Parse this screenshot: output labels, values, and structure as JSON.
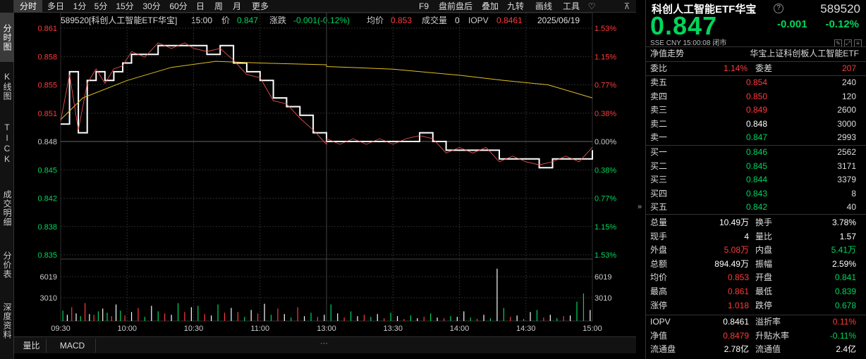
{
  "left_tabs": [
    {
      "label": "分时图",
      "active": true
    },
    {
      "label": "K线图",
      "active": false
    },
    {
      "label": "TICK",
      "active": false
    },
    {
      "label": "成交明细",
      "active": false
    },
    {
      "label": "分价表",
      "active": false
    },
    {
      "label": "深度资料",
      "active": false
    }
  ],
  "toolbar": {
    "tabs": [
      "分时",
      "多日",
      "1分",
      "5分",
      "15分",
      "30分",
      "60分",
      "日",
      "周",
      "月",
      "更多"
    ],
    "right_items": [
      "F9",
      "盘前盘后",
      "叠加",
      "九转",
      "画线",
      "工具"
    ],
    "favorite_icon": "heart-icon"
  },
  "infobar": {
    "name": "589520[科创人工智能ETF华宝]",
    "time": "15:00",
    "price_label": "价",
    "price": "0.847",
    "change_label": "涨跌",
    "change": "-0.001(-0.12%)",
    "avg_label": "均价",
    "avg": "0.853",
    "volume_label": "成交量",
    "volume": "0",
    "iopv_label": "IOPV",
    "iopv": "0.8461",
    "date": "2025/06/19"
  },
  "axes": {
    "price_ticks": [
      "0.861",
      "0.858",
      "0.855",
      "0.851",
      "0.848",
      "0.845",
      "0.842",
      "0.838",
      "0.835"
    ],
    "pct_ticks": [
      "1.53%",
      "1.15%",
      "0.77%",
      "0.38%",
      "0.00%",
      "0.38%",
      "0.77%",
      "1.15%",
      "1.53%"
    ],
    "volume_ticks": [
      "6019",
      "3010"
    ],
    "time_ticks": [
      "09:30",
      "10:00",
      "10:30",
      "11:00",
      "13:00",
      "13:30",
      "14:00",
      "14:30",
      "15:00"
    ]
  },
  "chart_data": {
    "type": "line",
    "x_range": [
      "09:30",
      "15:00"
    ],
    "ylim": [
      0.835,
      0.861
    ],
    "prev_close": 0.848,
    "series": [
      {
        "name": "价",
        "color": "#ffffff",
        "x": [
          "09:30",
          "09:34",
          "09:38",
          "09:42",
          "09:46",
          "09:50",
          "09:54",
          "09:58",
          "10:02",
          "10:08",
          "10:14",
          "10:20",
          "10:26",
          "10:30",
          "10:36",
          "10:42",
          "10:48",
          "10:54",
          "11:00",
          "11:06",
          "11:12",
          "11:18",
          "11:24",
          "11:30",
          "13:00",
          "13:06",
          "13:12",
          "13:18",
          "13:24",
          "13:30",
          "13:36",
          "13:42",
          "13:48",
          "13:54",
          "14:00",
          "14:06",
          "14:12",
          "14:18",
          "14:24",
          "14:30",
          "14:36",
          "14:42",
          "14:48",
          "14:54",
          "15:00"
        ],
        "y": [
          0.85,
          0.856,
          0.849,
          0.855,
          0.856,
          0.855,
          0.856,
          0.857,
          0.858,
          0.858,
          0.859,
          0.859,
          0.859,
          0.859,
          0.858,
          0.859,
          0.857,
          0.856,
          0.855,
          0.853,
          0.852,
          0.851,
          0.849,
          0.848,
          0.848,
          0.848,
          0.848,
          0.848,
          0.848,
          0.848,
          0.848,
          0.849,
          0.848,
          0.847,
          0.847,
          0.847,
          0.847,
          0.846,
          0.846,
          0.846,
          0.845,
          0.846,
          0.846,
          0.846,
          0.847
        ]
      },
      {
        "name": "均价",
        "color": "#e0c020",
        "x": [
          "09:30",
          "09:40",
          "10:00",
          "10:20",
          "10:40",
          "11:00",
          "11:30",
          "13:00",
          "13:30",
          "14:00",
          "14:20",
          "14:40",
          "15:00"
        ],
        "y": [
          0.8505,
          0.853,
          0.855,
          0.8565,
          0.8572,
          0.857,
          0.8568,
          0.8566,
          0.8563,
          0.8556,
          0.855,
          0.8545,
          0.853
        ]
      }
    ],
    "volume": {
      "ylim": [
        0,
        9000
      ],
      "times": [
        "09:31",
        "09:33",
        "09:35",
        "09:37",
        "09:39",
        "09:41",
        "09:43",
        "09:45",
        "09:47",
        "09:49",
        "09:51",
        "09:53",
        "09:55",
        "09:57",
        "09:59",
        "10:02",
        "10:05",
        "10:08",
        "10:11",
        "10:14",
        "10:17",
        "10:20",
        "10:23",
        "10:26",
        "10:29",
        "10:32",
        "10:35",
        "10:38",
        "10:41",
        "10:44",
        "10:47",
        "10:50",
        "10:53",
        "10:56",
        "10:59",
        "11:02",
        "11:05",
        "11:08",
        "11:11",
        "11:14",
        "11:17",
        "11:20",
        "11:23",
        "11:26",
        "11:29",
        "13:02",
        "13:05",
        "13:08",
        "13:11",
        "13:14",
        "13:17",
        "13:20",
        "13:23",
        "13:26",
        "13:29",
        "13:32",
        "13:35",
        "13:38",
        "13:41",
        "13:44",
        "13:47",
        "13:50",
        "13:53",
        "13:56",
        "13:59",
        "14:02",
        "14:05",
        "14:08",
        "14:11",
        "14:14",
        "14:17",
        "14:20",
        "14:23",
        "14:26",
        "14:29",
        "14:32",
        "14:35",
        "14:38",
        "14:41",
        "14:44",
        "14:47",
        "14:50",
        "14:53",
        "14:56",
        "14:59"
      ],
      "values": [
        1500,
        900,
        2000,
        1100,
        700,
        2600,
        1000,
        900,
        1400,
        1800,
        1200,
        700,
        2400,
        1500,
        800,
        1300,
        1900,
        600,
        2200,
        1400,
        1100,
        900,
        2600,
        1300,
        2000,
        2200,
        1000,
        800,
        2400,
        1200,
        1900,
        1300,
        600,
        1600,
        1100,
        2500,
        900,
        1800,
        1000,
        500,
        2000,
        700,
        1200,
        600,
        900,
        2400,
        1100,
        500,
        1400,
        700,
        900,
        600,
        1000,
        400,
        1200,
        700,
        300,
        800,
        400,
        600,
        1100,
        500,
        400,
        700,
        600,
        1400,
        500,
        300,
        900,
        400,
        7600,
        1900,
        600,
        800,
        300,
        1300,
        1600,
        500,
        900,
        400,
        700,
        800,
        2800,
        4000,
        1600
      ],
      "colors": [
        "g",
        "w",
        "r",
        "w",
        "g",
        "r",
        "w",
        "r",
        "g",
        "w",
        "g",
        "r",
        "w",
        "g",
        "r",
        "w",
        "r",
        "g",
        "w",
        "g",
        "r",
        "w",
        "g",
        "r",
        "w",
        "g",
        "r",
        "w",
        "g",
        "r",
        "w",
        "r",
        "g",
        "w",
        "r",
        "w",
        "g",
        "r",
        "w",
        "g",
        "r",
        "w",
        "g",
        "r",
        "w",
        "g",
        "w",
        "r",
        "g",
        "w",
        "r",
        "g",
        "w",
        "r",
        "g",
        "w",
        "r",
        "g",
        "w",
        "r",
        "g",
        "w",
        "r",
        "g",
        "w",
        "w",
        "g",
        "r",
        "w",
        "g",
        "w",
        "g",
        "r",
        "w",
        "g",
        "w",
        "g",
        "r",
        "w",
        "g",
        "r",
        "w",
        "g",
        "g",
        "w"
      ]
    }
  },
  "bottom_tabs": [
    "量比",
    "MACD"
  ],
  "quote": {
    "name": "科创人工智能ETF华宝",
    "code": "589520",
    "price": "0.847",
    "change": "-0.001",
    "change_pct": "-0.12%",
    "meta": "SSE   CNY   15:00:08   闭市",
    "nav_trend_label": "净值走势",
    "index_name": "华宝上证科创板人工智能ETF",
    "webi_label": "委比",
    "webi_value": "1.14%",
    "weicha_label": "委差",
    "weicha_value": "207",
    "asks": [
      {
        "label": "卖五",
        "price": "0.854",
        "vol": "240",
        "color": "red"
      },
      {
        "label": "卖四",
        "price": "0.850",
        "vol": "120",
        "color": "red"
      },
      {
        "label": "卖三",
        "price": "0.849",
        "vol": "2600",
        "color": "red"
      },
      {
        "label": "卖二",
        "price": "0.848",
        "vol": "3000",
        "color": "white"
      },
      {
        "label": "卖一",
        "price": "0.847",
        "vol": "2993",
        "color": "green"
      }
    ],
    "bids": [
      {
        "label": "买一",
        "price": "0.846",
        "vol": "2562",
        "color": "green"
      },
      {
        "label": "买二",
        "price": "0.845",
        "vol": "3171",
        "color": "green"
      },
      {
        "label": "买三",
        "price": "0.844",
        "vol": "3379",
        "color": "green"
      },
      {
        "label": "买四",
        "price": "0.843",
        "vol": "8",
        "color": "green"
      },
      {
        "label": "买五",
        "price": "0.842",
        "vol": "40",
        "color": "green"
      }
    ],
    "stats": [
      {
        "l1": "总量",
        "v1": "10.49万",
        "c1": "white",
        "l2": "换手",
        "v2": "3.78%",
        "c2": "white"
      },
      {
        "l1": "现手",
        "v1": "4",
        "c1": "white",
        "l2": "量比",
        "v2": "1.57",
        "c2": "white"
      },
      {
        "l1": "外盘",
        "v1": "5.08万",
        "c1": "red",
        "l2": "内盘",
        "v2": "5.41万",
        "c2": "green"
      },
      {
        "l1": "总额",
        "v1": "894.49万",
        "c1": "white",
        "l2": "振幅",
        "v2": "2.59%",
        "c2": "white"
      },
      {
        "l1": "均价",
        "v1": "0.853",
        "c1": "red",
        "l2": "开盘",
        "v2": "0.841",
        "c2": "green"
      },
      {
        "l1": "最高",
        "v1": "0.861",
        "c1": "red",
        "l2": "最低",
        "v2": "0.839",
        "c2": "green"
      },
      {
        "l1": "涨停",
        "v1": "1.018",
        "c1": "red",
        "l2": "跌停",
        "v2": "0.678",
        "c2": "green"
      }
    ],
    "extra": [
      {
        "l1": "IOPV",
        "v1": "0.8461",
        "c1": "white",
        "l2": "溢折率",
        "v2": "0.11%",
        "c2": "red"
      },
      {
        "l1": "净值",
        "v1": "0.8479",
        "c1": "red",
        "l2": "升贴水率",
        "v2": "-0.11%",
        "c2": "green"
      },
      {
        "l1": "流通盘",
        "v1": "2.78亿",
        "c1": "white",
        "l2": "流通值",
        "v2": "2.4亿",
        "c2": "white"
      }
    ]
  }
}
